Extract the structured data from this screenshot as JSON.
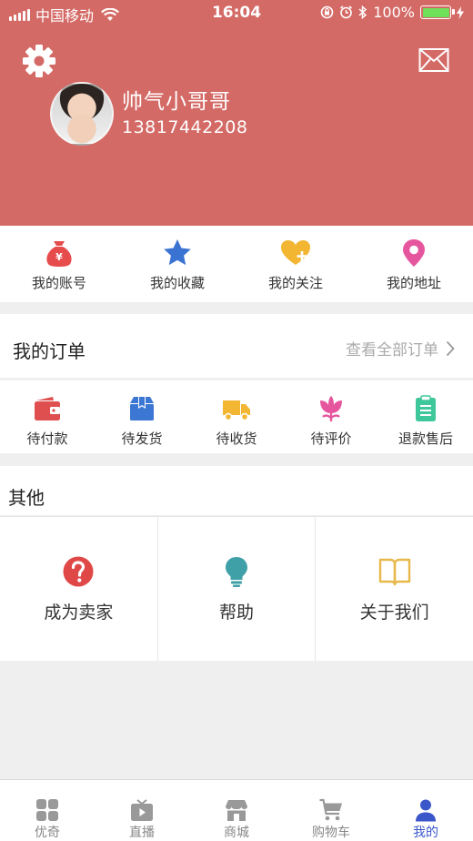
{
  "status_bar": {
    "carrier": "中国移动",
    "time": "16:04",
    "battery": "100%",
    "battery_level": 1.0
  },
  "header": {
    "settings_icon": "gear-icon",
    "message_icon": "mail-icon",
    "user_name": "帅气小哥哥",
    "phone": "13817442208",
    "bg_color": "#d46a66"
  },
  "quick_menu": [
    {
      "label": "我的账号",
      "icon": "money-bag-icon",
      "color": "#e74c4c"
    },
    {
      "label": "我的收藏",
      "icon": "star-icon",
      "color": "#3a73d1"
    },
    {
      "label": "我的关注",
      "icon": "heart-plus-icon",
      "color": "#f2b632"
    },
    {
      "label": "我的地址",
      "icon": "location-pin-icon",
      "color": "#e6569e"
    }
  ],
  "orders": {
    "title": "我的订单",
    "view_all": "查看全部订单",
    "items": [
      {
        "label": "待付款",
        "icon": "wallet-icon",
        "color": "#e04f4f"
      },
      {
        "label": "待发货",
        "icon": "box-icon",
        "color": "#3d77d4"
      },
      {
        "label": "待收货",
        "icon": "truck-icon",
        "color": "#f2b632"
      },
      {
        "label": "待评价",
        "icon": "flower-icon",
        "color": "#e6569e"
      },
      {
        "label": "退款售后",
        "icon": "clipboard-icon",
        "color": "#3fc79c"
      }
    ]
  },
  "others": {
    "title": "其他",
    "items": [
      {
        "label": "成为卖家",
        "icon": "question-icon",
        "color": "#e04848"
      },
      {
        "label": "帮助",
        "icon": "lightbulb-icon",
        "color": "#3fa0a8"
      },
      {
        "label": "关于我们",
        "icon": "book-icon",
        "color": "#e8b84a"
      }
    ]
  },
  "tab_bar": [
    {
      "label": "优奇",
      "icon": "grid-icon",
      "active": false
    },
    {
      "label": "直播",
      "icon": "tv-play-icon",
      "active": false
    },
    {
      "label": "商城",
      "icon": "store-icon",
      "active": false
    },
    {
      "label": "购物车",
      "icon": "cart-icon",
      "active": false
    },
    {
      "label": "我的",
      "icon": "user-icon",
      "active": true
    }
  ],
  "accent_color": "#3a56c9"
}
